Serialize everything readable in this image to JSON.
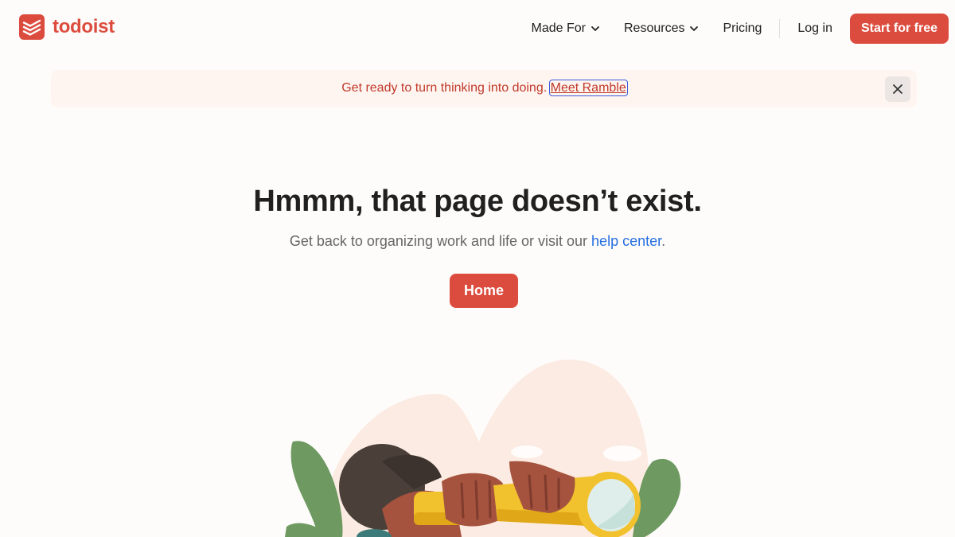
{
  "header": {
    "logo_text": "todoist",
    "nav": {
      "made_for": "Made For",
      "resources": "Resources",
      "pricing": "Pricing",
      "login": "Log in",
      "start": "Start for free"
    }
  },
  "banner": {
    "text": "Get ready to turn thinking into doing.",
    "link": "Meet Ramble",
    "close_icon": "close-icon"
  },
  "main": {
    "headline": "Hmmm, that page doesn’t exist.",
    "sub_before": "Get back to organizing work and life or visit our",
    "sub_link": "help center",
    "sub_after": ".",
    "home_button": "Home"
  },
  "colors": {
    "brand": "#dc4c3e",
    "banner_bg": "#fff5f0",
    "link_blue": "#246fe0",
    "background": "#fefcfa"
  },
  "icons": [
    "todoist-logo-icon",
    "chevron-down-icon",
    "close-icon"
  ]
}
